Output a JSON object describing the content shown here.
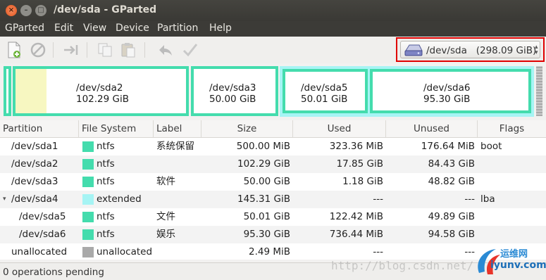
{
  "window": {
    "title": "/dev/sda - GParted"
  },
  "menu": [
    "GParted",
    "Edit",
    "View",
    "Device",
    "Partition",
    "Help"
  ],
  "toolbar": {
    "icons": [
      "new-partition-icon",
      "delete-icon",
      "resize-move-icon",
      "copy-icon",
      "paste-icon",
      "undo-icon",
      "apply-icon"
    ],
    "device_selector": "/dev/sda   (298.09 GiB)"
  },
  "map": {
    "sda2": {
      "name": "/dev/sda2",
      "size": "102.29 GiB"
    },
    "sda3": {
      "name": "/dev/sda3",
      "size": "50.00 GiB"
    },
    "sda5": {
      "name": "/dev/sda5",
      "size": "50.01 GiB"
    },
    "sda6": {
      "name": "/dev/sda6",
      "size": "95.30 GiB"
    }
  },
  "table": {
    "columns": [
      "Partition",
      "File System",
      "Label",
      "Size",
      "Used",
      "Unused",
      "Flags"
    ],
    "rows": [
      {
        "partition": "/dev/sda1",
        "fs": "ntfs",
        "fs_color": "#44dcad",
        "label": "系统保留",
        "size": "500.00 MiB",
        "used": "323.36 MiB",
        "unused": "176.64 MiB",
        "flags": "boot"
      },
      {
        "partition": "/dev/sda2",
        "fs": "ntfs",
        "fs_color": "#44dcad",
        "label": "",
        "size": "102.29 GiB",
        "used": "17.85 GiB",
        "unused": "84.43 GiB",
        "flags": ""
      },
      {
        "partition": "/dev/sda3",
        "fs": "ntfs",
        "fs_color": "#44dcad",
        "label": "软件",
        "size": "50.00 GiB",
        "used": "1.18 GiB",
        "unused": "48.82 GiB",
        "flags": ""
      },
      {
        "partition": "/dev/sda4",
        "fs": "extended",
        "fs_color": "#a6f4f4",
        "label": "",
        "size": "145.31 GiB",
        "used": "---",
        "unused": "---",
        "flags": "lba"
      },
      {
        "partition": "/dev/sda5",
        "fs": "ntfs",
        "fs_color": "#44dcad",
        "label": "文件",
        "size": "50.01 GiB",
        "used": "122.42 MiB",
        "unused": "49.89 GiB",
        "flags": ""
      },
      {
        "partition": "/dev/sda6",
        "fs": "ntfs",
        "fs_color": "#44dcad",
        "label": "娱乐",
        "size": "95.30 GiB",
        "used": "736.44 MiB",
        "unused": "94.58 GiB",
        "flags": ""
      },
      {
        "partition": "unallocated",
        "fs": "unallocated",
        "fs_color": "#a9a9a9",
        "label": "",
        "size": "2.49 MiB",
        "used": "---",
        "unused": "---",
        "flags": ""
      }
    ]
  },
  "status": {
    "text": "0 operations pending"
  },
  "watermark": {
    "text": "http://blog.csdn.net/",
    "logo_top": "运维网",
    "logo_bottom": "iyunv.com"
  }
}
